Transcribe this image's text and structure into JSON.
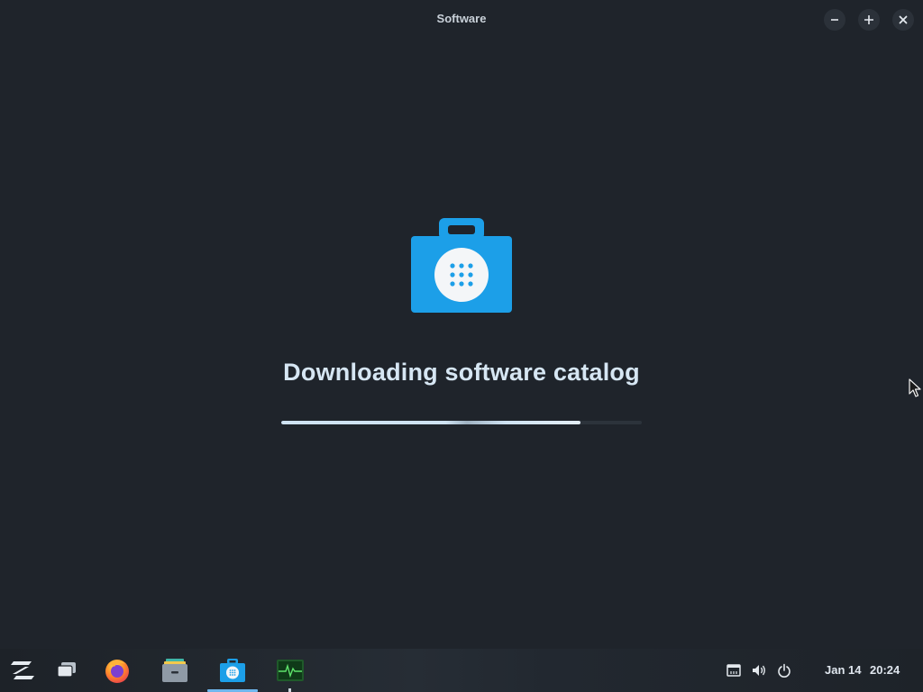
{
  "window": {
    "title": "Software",
    "minimize_icon": "minimize-icon",
    "restore_icon": "restore-icon",
    "close_icon": "close-icon"
  },
  "main": {
    "app_icon": "software-bag-icon",
    "heading": "Downloading software catalog",
    "progress": 0.83
  },
  "taskbar": {
    "items": [
      {
        "name": "zorin-menu",
        "icon": "zorin-logo-icon"
      },
      {
        "name": "workspaces",
        "icon": "windows-icon"
      },
      {
        "name": "firefox",
        "icon": "firefox-icon"
      },
      {
        "name": "files",
        "icon": "files-icon"
      },
      {
        "name": "software",
        "icon": "software-icon",
        "active": true
      },
      {
        "name": "system-monitor",
        "icon": "system-monitor-icon"
      }
    ],
    "tray": [
      "network-icon",
      "volume-icon",
      "power-icon"
    ],
    "date": "Jan 14",
    "time": "20:24"
  },
  "colors": {
    "background": "#1f242b",
    "accent": "#1c9fe8",
    "heading": "#d6e6f3"
  }
}
